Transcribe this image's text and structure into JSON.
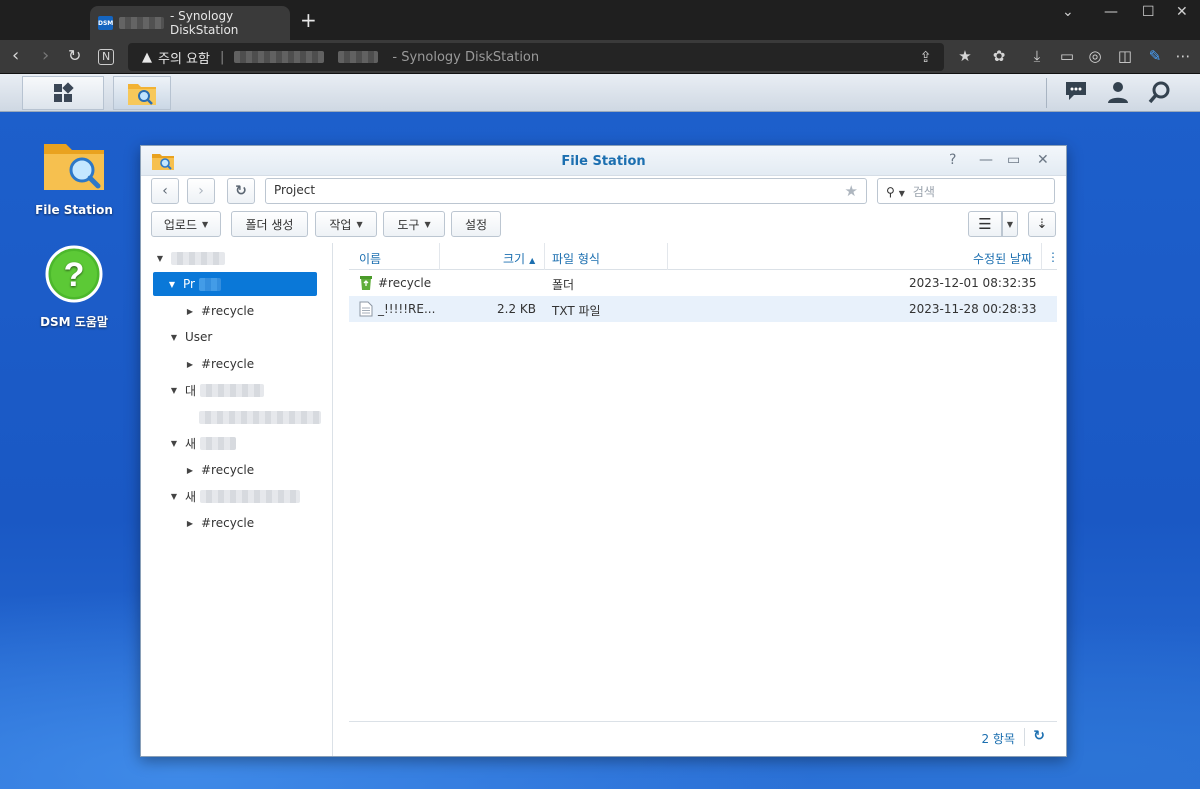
{
  "browser": {
    "tab_title": "- Synology DiskStation",
    "tab_favicon_text": "DSM",
    "new_tab": "+",
    "warning_label": "주의 요함",
    "url_title": "- Synology DiskStation"
  },
  "dsm_desktop": {
    "icons": [
      {
        "label": "File Station"
      },
      {
        "label": "DSM 도움말"
      }
    ]
  },
  "file_station": {
    "title": "File Station",
    "path": "Project",
    "search_placeholder": "검색",
    "toolbar": {
      "upload": "업로드",
      "new_folder": "폴더 생성",
      "action": "작업",
      "tools": "도구",
      "settings": "설정"
    },
    "tree": [
      {
        "label": "",
        "level": 0,
        "expanded": true
      },
      {
        "label": "Pr",
        "level": 1,
        "expanded": true,
        "selected": true
      },
      {
        "label": "#recycle",
        "level": 2,
        "expanded": false
      },
      {
        "label": "User",
        "level": 1,
        "expanded": true
      },
      {
        "label": "#recycle",
        "level": 2,
        "expanded": false
      },
      {
        "label": "대",
        "level": 1,
        "expanded": true
      },
      {
        "label": "",
        "level": 2,
        "expanded": false
      },
      {
        "label": "새",
        "level": 1,
        "expanded": true
      },
      {
        "label": "#recycle",
        "level": 2,
        "expanded": false
      },
      {
        "label": "새",
        "level": 1,
        "expanded": true
      },
      {
        "label": "#recycle",
        "level": 2,
        "expanded": false
      }
    ],
    "columns": {
      "name": "이름",
      "size": "크기",
      "type": "파일 형식",
      "modified": "수정된 날짜"
    },
    "rows": [
      {
        "name": "#recycle",
        "size": "",
        "type": "폴더",
        "modified": "2023-12-01 08:32:35",
        "icon": "recycle-folder-icon"
      },
      {
        "name": "_!!!!!RE...",
        "size": "2.2 KB",
        "type": "TXT 파일",
        "modified": "2023-11-28 00:28:33",
        "icon": "text-file-icon"
      }
    ],
    "item_count": "2 항목"
  },
  "colors": {
    "accent": "#1c6fb0",
    "selection": "#0a78d8",
    "desktop": "#1d5fcb"
  }
}
